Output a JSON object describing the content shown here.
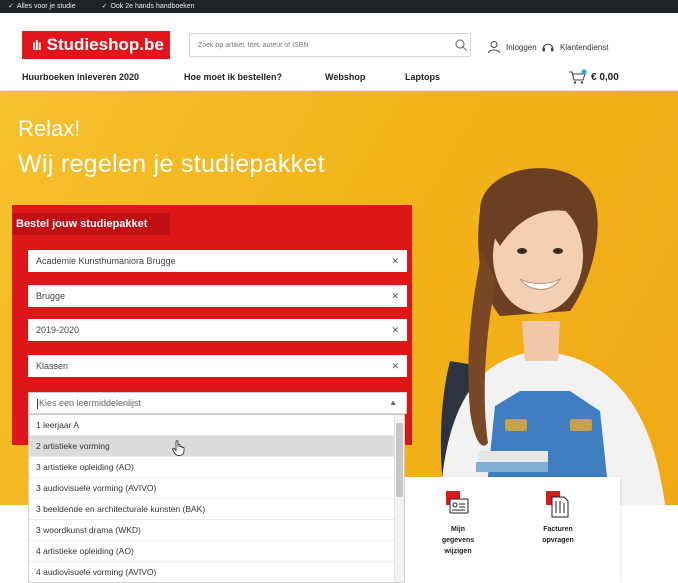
{
  "topstrip": {
    "items": [
      "Alles voor je studie",
      "Ook 2e hands handboeken"
    ]
  },
  "header": {
    "logo_text": "Studieshop.be",
    "search_placeholder": "Zoek op artikel, titel, auteur of ISBN",
    "login_label": "Inloggen",
    "service_label": "Klantendienst"
  },
  "nav": {
    "items": [
      "Huurboeken inleveren 2020",
      "Hoe moet ik bestellen?",
      "Webshop",
      "Laptops"
    ],
    "cart_total": "€ 0,00"
  },
  "hero": {
    "title1": "Relax!",
    "title2": "Wij regelen je studiepakket"
  },
  "form": {
    "title": "Bestel jouw studiepakket",
    "fields": [
      "Academie Kunsthumaniora Brugge",
      "Brugge",
      "2019-2020",
      "Klassen"
    ],
    "combo_placeholder": "Kies een leermiddelenlijst",
    "options": [
      "1 leerjaar A",
      "2 artistieke vorming",
      "3 artistieke opleiding (AO)",
      "3 audiovisuele vorming (AVIVO)",
      "3 beeldende en architecturale kunsten (BAK)",
      "3 woordkunst drama (WKD)",
      "4 artistieke opleiding (AO)",
      "4 audiovisuele vorming (AVIVO)"
    ],
    "hovered_option": "2 artistieke vorming"
  },
  "cards": {
    "card1_lines": [
      "Mijn",
      "gegevens",
      "wijzigen"
    ],
    "card2_lines": [
      "Facturen",
      "opvragen"
    ]
  },
  "colors": {
    "brand_red": "#e2141c",
    "hero_yellow": "#f3b51b",
    "dark_strip": "#1f2227"
  }
}
